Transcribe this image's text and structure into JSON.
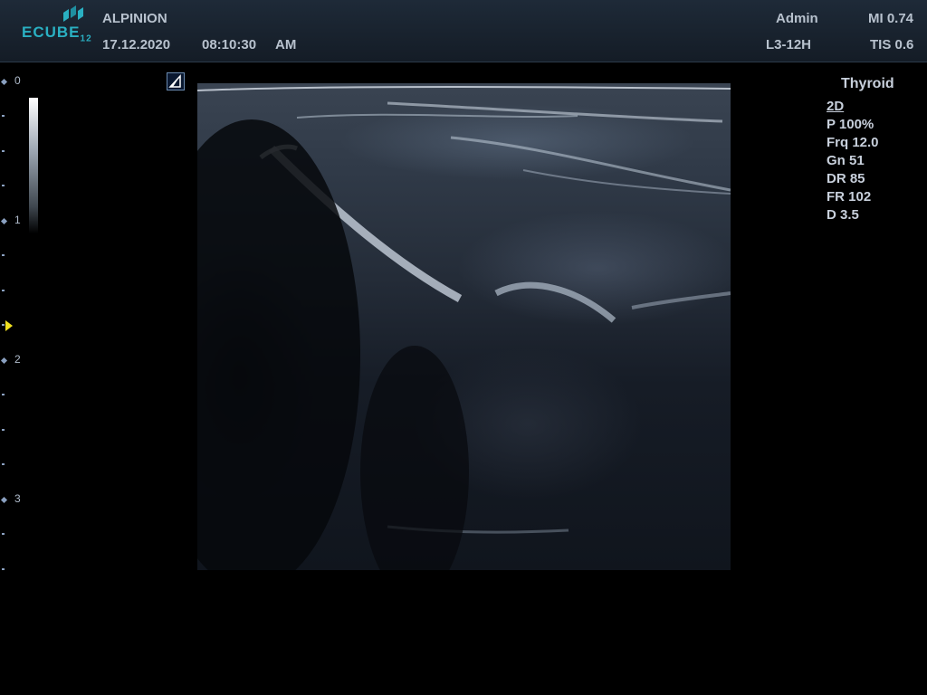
{
  "header": {
    "logo_text": "ECUBE",
    "logo_sub": "12",
    "manufacturer": "ALPINION",
    "date": "17.12.2020",
    "time": "08:10:30",
    "ampm": "AM",
    "user": "Admin",
    "probe": "L3-12H",
    "mi": "MI 0.74",
    "tis": "TIS 0.6"
  },
  "depth_scale": {
    "labels": [
      "0",
      "1",
      "2",
      "3"
    ]
  },
  "params": {
    "preset": "Thyroid",
    "mode": "2D",
    "items": [
      "P 100%",
      "Frq 12.0",
      "Gn 51",
      "DR 85",
      "FR 102",
      "D 3.5"
    ]
  },
  "colors": {
    "header_bg": "#1a2430",
    "logo": "#2ab0c2",
    "focus_marker": "#f0e020",
    "depth_scale": "#8aa0c0"
  },
  "icons": {
    "orientation": "orientation-marker-icon",
    "focus": "focus-marker-icon"
  }
}
